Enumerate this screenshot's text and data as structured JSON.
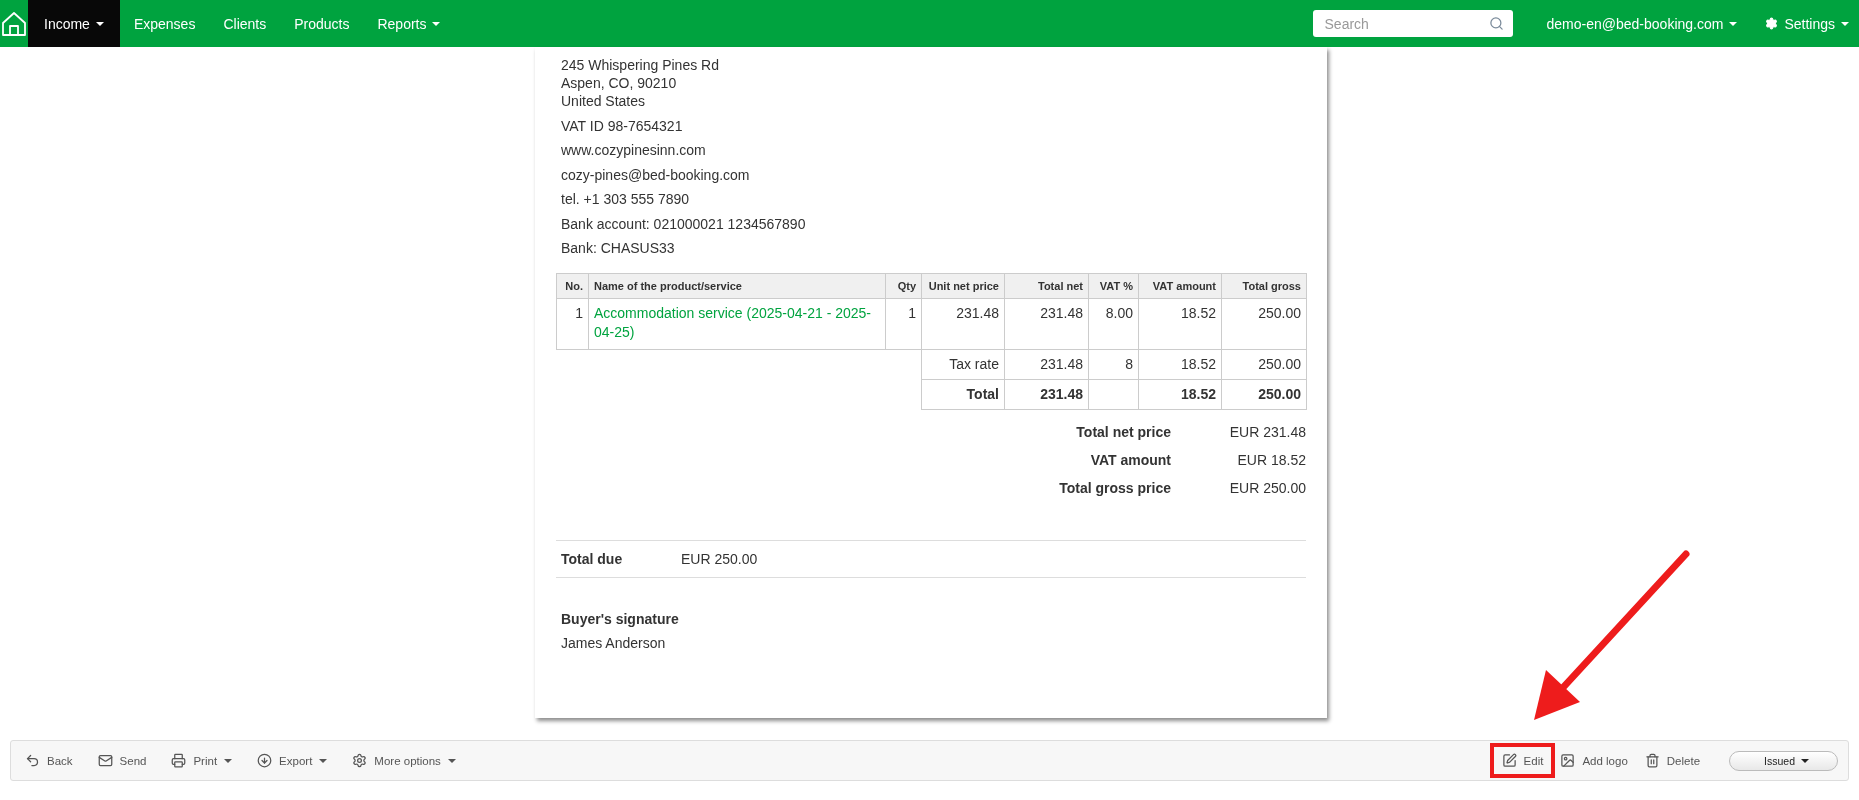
{
  "nav": {
    "items": [
      {
        "label": "Income",
        "selected": true,
        "dropdown": true
      },
      {
        "label": "Expenses",
        "selected": false,
        "dropdown": false
      },
      {
        "label": "Clients",
        "selected": false,
        "dropdown": false
      },
      {
        "label": "Products",
        "selected": false,
        "dropdown": false
      },
      {
        "label": "Reports",
        "selected": false,
        "dropdown": true
      }
    ],
    "search": {
      "placeholder": "Search"
    },
    "account": {
      "label": "demo-en@bed-booking.com",
      "dropdown": true
    },
    "settings": {
      "label": "Settings",
      "dropdown": true
    }
  },
  "seller": {
    "address_lines": [
      "245 Whispering Pines Rd",
      "Aspen, CO, 90210",
      "United States"
    ],
    "details": [
      "VAT ID 98-7654321",
      "www.cozypinesinn.com",
      "cozy-pines@bed-booking.com",
      "tel. +1 303 555 7890",
      "Bank account: 021000021 1234567890",
      "Bank: CHASUS33"
    ]
  },
  "table": {
    "columns": [
      "No.",
      "Name of the product/service",
      "Qty",
      "Unit net price",
      "Total net",
      "VAT %",
      "VAT amount",
      "Total gross"
    ],
    "rows": [
      {
        "no": "1",
        "name": "Accommodation service (2025-04-21 - 2025-04-25)",
        "qty": "1",
        "unit_net": "231.48",
        "total_net": "231.48",
        "vat_pct": "8.00",
        "vat_amount": "18.52",
        "total_gross": "250.00"
      }
    ],
    "summary_rows": [
      {
        "kind": "rate",
        "label": "Tax rate",
        "total_net": "231.48",
        "vat_pct": "8",
        "vat_amount": "18.52",
        "total_gross": "250.00"
      },
      {
        "kind": "total",
        "label": "Total",
        "total_net": "231.48",
        "vat_amount": "18.52",
        "total_gross": "250.00"
      }
    ]
  },
  "totals": [
    {
      "label": "Total net price",
      "value": "EUR 231.48"
    },
    {
      "label": "VAT amount",
      "value": "EUR 18.52"
    },
    {
      "label": "Total gross price",
      "value": "EUR 250.00"
    }
  ],
  "total_due": {
    "label": "Total due",
    "value": "EUR 250.00"
  },
  "signature": {
    "label": "Buyer's signature",
    "name": "James Anderson"
  },
  "toolbar": {
    "left": [
      {
        "kind": "back",
        "label": "Back",
        "dropdown": false
      },
      {
        "kind": "send",
        "label": "Send",
        "dropdown": false
      },
      {
        "kind": "print",
        "label": "Print",
        "dropdown": true
      },
      {
        "kind": "export",
        "label": "Export",
        "dropdown": true
      },
      {
        "kind": "options",
        "label": "More options",
        "dropdown": true
      }
    ],
    "right": [
      {
        "kind": "edit",
        "label": "Edit",
        "highlighted": true
      },
      {
        "kind": "logo",
        "label": "Add logo",
        "highlighted": false
      },
      {
        "kind": "delete",
        "label": "Delete",
        "highlighted": false
      }
    ],
    "status": {
      "label": "Issued"
    }
  }
}
